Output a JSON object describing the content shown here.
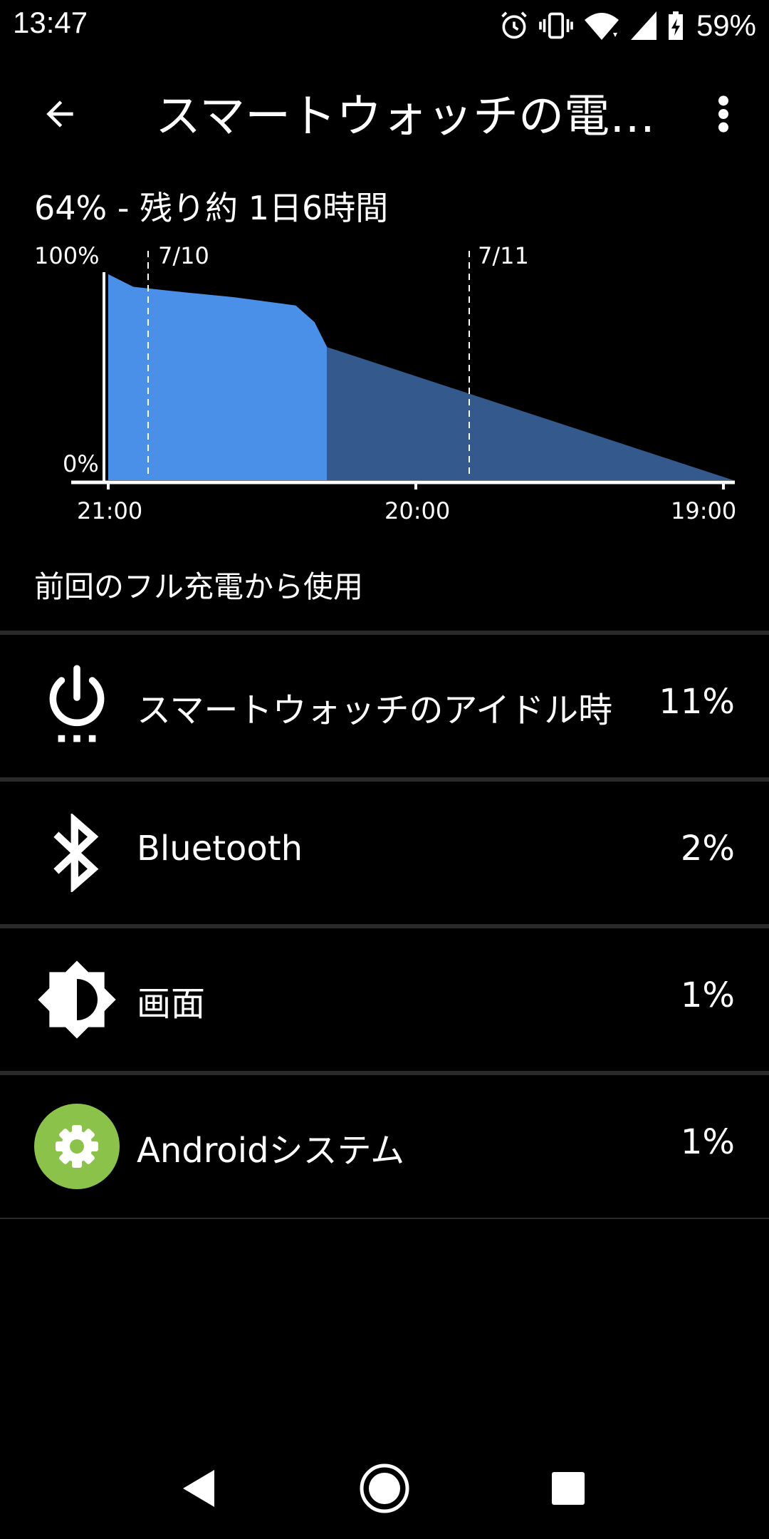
{
  "status_bar": {
    "time": "13:47",
    "battery_percent": "59%",
    "icons": [
      "alarm-icon",
      "vibrate-icon",
      "wifi-icon",
      "cell-signal-icon",
      "battery-charging-icon"
    ]
  },
  "app_bar": {
    "title": "スマートウォッチの電…",
    "back_icon": "arrow-back-icon",
    "more_icon": "more-vert-icon"
  },
  "summary": "64% - 残り約 1日6時間",
  "chart_data": {
    "type": "area",
    "y_labels": [
      "100%",
      "0%"
    ],
    "x_labels": [
      "21:00",
      "20:00",
      "19:00"
    ],
    "date_markers": [
      "7/10",
      "7/11"
    ],
    "colors": {
      "actual": "#4a8fe8",
      "projected": "#34598c"
    },
    "series": [
      {
        "role": "actual",
        "points": [
          [
            0,
            99
          ],
          [
            0.04,
            93
          ],
          [
            0.1,
            91
          ],
          [
            0.2,
            88
          ],
          [
            0.3,
            84
          ],
          [
            0.33,
            76
          ],
          [
            0.35,
            64
          ]
        ]
      },
      {
        "role": "projected",
        "points": [
          [
            0.35,
            64
          ],
          [
            1.0,
            0
          ]
        ]
      }
    ]
  },
  "section_label": "前回のフル充電から使用",
  "usage_items": [
    {
      "label": "スマートウォッチのアイドル時",
      "percent": "11%",
      "icon": "power-idle-icon"
    },
    {
      "label": "Bluetooth",
      "percent": "2%",
      "icon": "bluetooth-icon"
    },
    {
      "label": "画面",
      "percent": "1%",
      "icon": "brightness-icon"
    },
    {
      "label": "Androidシステム",
      "percent": "1%",
      "icon": "android-system-gear-icon"
    }
  ],
  "nav_bar": {
    "icons": [
      "nav-back-icon",
      "nav-home-icon",
      "nav-recents-icon"
    ]
  }
}
